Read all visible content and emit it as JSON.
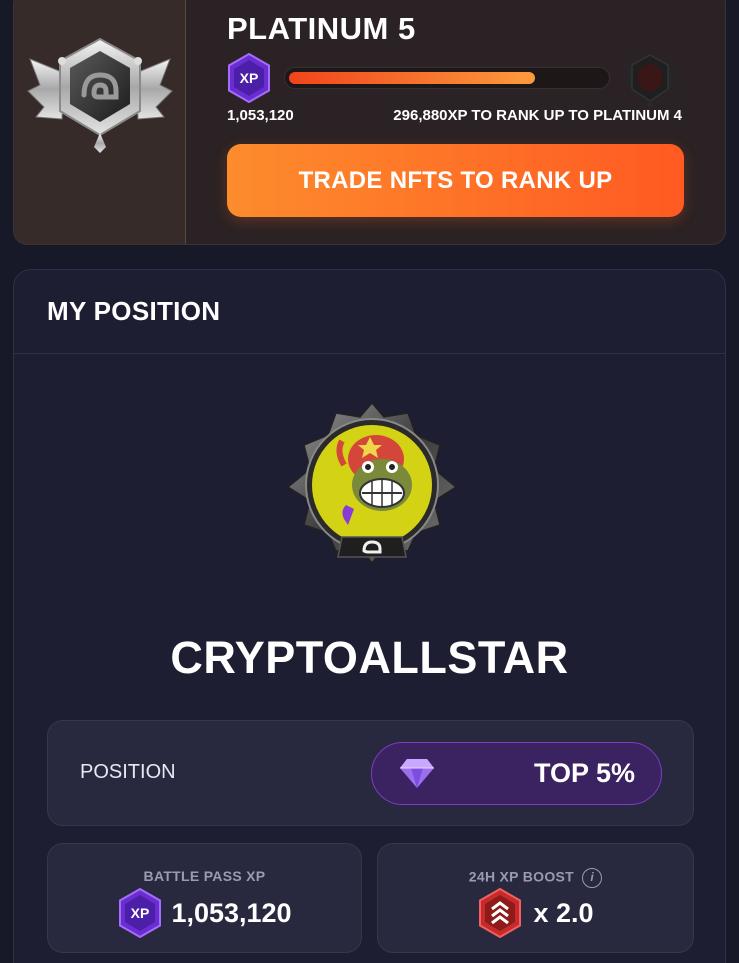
{
  "rank_card": {
    "title": "PLATINUM 5",
    "xp_badge": "XP",
    "xp_current": "1,053,120",
    "xp_to_rank": "296,880XP TO RANK UP TO PLATINUM 4",
    "progress_fraction": 0.78,
    "trade_button_label": "TRADE NFTS TO RANK UP",
    "current_rank_icon": "platinum-rank-badge-icon",
    "next_rank_icon": "next-rank-badge-icon"
  },
  "position_card": {
    "title": "MY POSITION",
    "username": "CRYPTOALLSTAR",
    "position_label": "POSITION",
    "position_value": "TOP 5%",
    "battle_pass_label": "BATTLE PASS XP",
    "battle_pass_xp": "1,053,120",
    "battle_pass_badge": "XP",
    "boost_label": "24H XP BOOST",
    "boost_info": "i",
    "boost_value": "x 2.0"
  },
  "colors": {
    "background": "#171828",
    "accent_orange": "#ff5a22",
    "accent_purple": "#7c3cc8"
  }
}
